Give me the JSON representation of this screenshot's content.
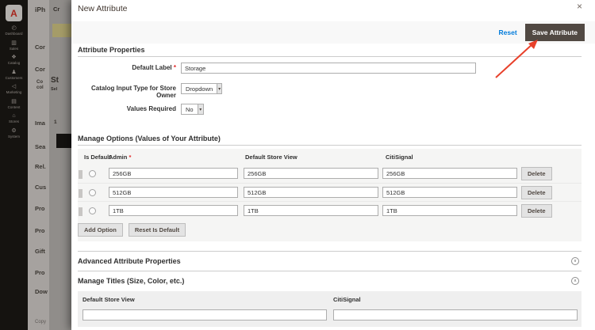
{
  "icons": {
    "close": "×",
    "chevron_down": "∨",
    "chevron_up": "∧",
    "dropdown_arrow": "▾",
    "logo_letter": "A"
  },
  "sidebar": {
    "items": [
      {
        "label": "Dashboard",
        "glyph": "◴"
      },
      {
        "label": "Sales",
        "glyph": "▥"
      },
      {
        "label": "Catalog",
        "glyph": "❖"
      },
      {
        "label": "Customers",
        "glyph": "♟"
      },
      {
        "label": "Marketing",
        "glyph": "◁"
      },
      {
        "label": "Content",
        "glyph": "▤"
      },
      {
        "label": "Stores",
        "glyph": "⌂"
      },
      {
        "label": "System",
        "glyph": "⚙"
      }
    ]
  },
  "background_page": {
    "fragments": [
      "iPh",
      "Cor",
      "Cor",
      "Co",
      "col",
      "Ima",
      "Sea",
      "Rel.",
      "Cus",
      "Pro",
      "Pro",
      "Gift",
      "Pro",
      "Dow",
      "Copy"
    ]
  },
  "wizard_panel": {
    "fragments": [
      "Cr",
      "St",
      "Sel",
      "1"
    ]
  },
  "modal": {
    "title": "New Attribute",
    "toolbar": {
      "reset": "Reset",
      "save": "Save Attribute"
    },
    "attribute_properties": {
      "heading": "Attribute Properties",
      "rows": [
        {
          "label": "Default Label",
          "required": "*",
          "value": "Storage"
        },
        {
          "label": "Catalog Input Type for Store Owner",
          "value": "Dropdown"
        },
        {
          "label": "Values Required",
          "value": "No"
        }
      ]
    },
    "manage_options": {
      "heading": "Manage Options (Values of Your Attribute)",
      "headers": {
        "is_default": "Is Default",
        "admin": "Admin",
        "admin_required": "*",
        "default_store_view": "Default Store View",
        "citisignal": "CitiSignal"
      },
      "rows": [
        {
          "admin": "256GB",
          "default_store_view": "256GB",
          "citisignal": "256GB",
          "delete": "Delete"
        },
        {
          "admin": "512GB",
          "default_store_view": "512GB",
          "citisignal": "512GB",
          "delete": "Delete"
        },
        {
          "admin": "1TB",
          "default_store_view": "1TB",
          "citisignal": "1TB",
          "delete": "Delete"
        }
      ],
      "add_option": "Add Option",
      "reset_is_default": "Reset Is Default"
    },
    "advanced": {
      "heading": "Advanced Attribute Properties"
    },
    "manage_titles": {
      "heading": "Manage Titles (Size, Color, etc.)",
      "headers": {
        "default_store_view": "Default Store View",
        "citisignal": "CitiSignal"
      }
    }
  },
  "colors": {
    "accent_blue": "#007bdb",
    "save_button": "#514943",
    "arrow_red": "#e8402a",
    "required_red": "#e22626"
  }
}
